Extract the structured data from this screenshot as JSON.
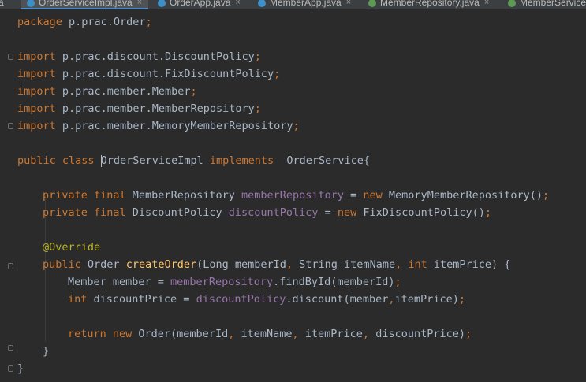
{
  "tabs": [
    {
      "label": "a",
      "icon": "none"
    },
    {
      "label": "OrderServiceImpl.java",
      "icon": "java-class-icon",
      "active": true
    },
    {
      "label": "OrderApp.java",
      "icon": "java-class-icon"
    },
    {
      "label": "MemberApp.java",
      "icon": "java-class-icon"
    },
    {
      "label": "MemberRepository.java",
      "icon": "interface-icon"
    },
    {
      "label": "MemberService",
      "icon": "interface-icon"
    }
  ],
  "close_glyph": "×",
  "colors": {
    "keyword": "#cc7832",
    "field": "#9876aa",
    "method": "#ffc66d",
    "annotation": "#bbb529",
    "text": "#a9b7c6",
    "background": "#2b2b2b"
  },
  "code": {
    "package": {
      "kw": "package",
      "name": " p.prac.Order",
      "semi": ";"
    },
    "imports": [
      {
        "kw": "import",
        "name": " p.prac.discount.DiscountPolicy",
        "semi": ";"
      },
      {
        "kw": "import",
        "name": " p.prac.discount.FixDiscountPolicy",
        "semi": ";"
      },
      {
        "kw": "import",
        "name": " p.prac.member.Member",
        "semi": ";"
      },
      {
        "kw": "import",
        "name": " p.prac.member.MemberRepository",
        "semi": ";"
      },
      {
        "kw": "import",
        "name": " p.prac.member.MemoryMemberRepository",
        "semi": ";"
      }
    ],
    "class_decl": {
      "kw1": "public class ",
      "name": "OrderServiceImpl",
      "kw2": " implements ",
      "iface": " OrderService{"
    },
    "field1": {
      "kw": "private final ",
      "type": "MemberRepository ",
      "name": "memberRepository",
      "eq": " = ",
      "new": "new ",
      "init": "MemoryMemberRepository()",
      "semi": ";"
    },
    "field2": {
      "kw": "private final ",
      "type": "DiscountPolicy ",
      "name": "discountPolicy",
      "eq": " = ",
      "new": "new ",
      "init": "FixDiscountPolicy()",
      "semi": ";"
    },
    "annotation": "@Override",
    "method_decl": {
      "kw": "public ",
      "type": "Order ",
      "name": "createOrder",
      "p1": "(Long memberId",
      "c1": ",",
      "p2": " String itemName",
      "c2": ",",
      "kw_int": " int",
      "p3": " itemPrice) {"
    },
    "stmt1": {
      "type": "Member member = ",
      "field": "memberRepository",
      "rest": ".findById(memberId)",
      "semi": ";"
    },
    "stmt2": {
      "kw": "int",
      "decl": " discountPrice = ",
      "field": "discountPolicy",
      "rest": ".discount(member",
      "comma": ",",
      "rest2": "itemPrice)",
      "semi": ";"
    },
    "stmt3": {
      "kw": "return new ",
      "call": "Order(memberId",
      "c1": ",",
      "a2": " itemName",
      "c2": ",",
      "a3": " itemPrice",
      "c3": ",",
      "a4": " discountPrice)",
      "semi": ";"
    },
    "close_method": "}",
    "close_class": "}"
  }
}
